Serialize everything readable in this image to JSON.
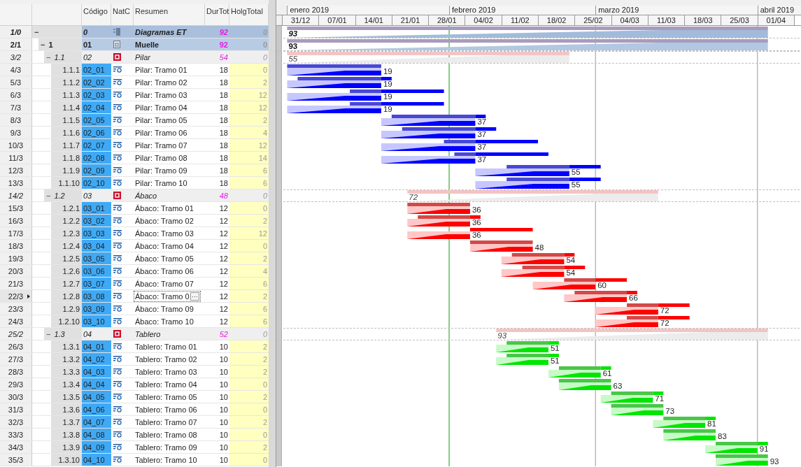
{
  "columns": [
    "Código",
    "NatC",
    "Resumen",
    "DurTot",
    "HolgTotal"
  ],
  "months": [
    "enero 2019",
    "febrero 2019",
    "marzo 2019",
    "abril 2019"
  ],
  "weeks": [
    "31/12",
    "07/01",
    "14/01",
    "21/01",
    "28/01",
    "04/02",
    "11/02",
    "18/02",
    "25/02",
    "04/03",
    "11/03",
    "18/03",
    "25/03",
    "01/04"
  ],
  "rows": [
    {
      "kind": "root",
      "num": "1/0",
      "toggle": "−",
      "selected": false,
      "code": "0",
      "summary": "Diagramas ET",
      "dur": "92",
      "holg": "0",
      "bar_label": "93",
      "children": [
        {
          "kind": "chapter",
          "num": "2/1",
          "toggle": "−",
          "index": "1",
          "selected": false,
          "code": "01",
          "summary": "Muelle",
          "dur": "92",
          "holg": "0",
          "bar_label": "93",
          "children": [
            {
              "kind": "group",
              "num": "3/2",
              "toggle": "−",
              "index": "1.1",
              "selected": false,
              "code": "02",
              "summary": "Pilar",
              "dur": "54",
              "holg": "0",
              "bar_label": "55",
              "color": "#0000ff",
              "children": [
                {
                  "kind": "task",
                  "num": "4/3",
                  "index": "1.1.1",
                  "selected": false,
                  "code": "02_01",
                  "summary": "Pilar: Tramo 01",
                  "dur": "18",
                  "holg": "0",
                  "bar_label": "19"
                },
                {
                  "kind": "task",
                  "num": "5/3",
                  "index": "1.1.2",
                  "selected": false,
                  "code": "02_02",
                  "summary": "Pilar: Tramo 02",
                  "dur": "18",
                  "holg": "2",
                  "bar_label": "19"
                },
                {
                  "kind": "task",
                  "num": "6/3",
                  "index": "1.1.3",
                  "selected": false,
                  "code": "02_03",
                  "summary": "Pilar: Tramo 03",
                  "dur": "18",
                  "holg": "12",
                  "bar_label": "19"
                },
                {
                  "kind": "task",
                  "num": "7/3",
                  "index": "1.1.4",
                  "selected": false,
                  "code": "02_04",
                  "summary": "Pilar: Tramo 04",
                  "dur": "18",
                  "holg": "12",
                  "bar_label": "19"
                },
                {
                  "kind": "task",
                  "num": "8/3",
                  "index": "1.1.5",
                  "selected": false,
                  "code": "02_05",
                  "summary": "Pilar: Tramo 05",
                  "dur": "18",
                  "holg": "2",
                  "bar_label": "37"
                },
                {
                  "kind": "task",
                  "num": "9/3",
                  "index": "1.1.6",
                  "selected": false,
                  "code": "02_06",
                  "summary": "Pilar: Tramo 06",
                  "dur": "18",
                  "holg": "4",
                  "bar_label": "37"
                },
                {
                  "kind": "task",
                  "num": "10/3",
                  "index": "1.1.7",
                  "selected": false,
                  "code": "02_07",
                  "summary": "Pilar: Tramo 07",
                  "dur": "18",
                  "holg": "12",
                  "bar_label": "37"
                },
                {
                  "kind": "task",
                  "num": "11/3",
                  "index": "1.1.8",
                  "selected": false,
                  "code": "02_08",
                  "summary": "Pilar: Tramo 08",
                  "dur": "18",
                  "holg": "14",
                  "bar_label": "37"
                },
                {
                  "kind": "task",
                  "num": "12/3",
                  "index": "1.1.9",
                  "selected": false,
                  "code": "02_09",
                  "summary": "Pilar: Tramo 09",
                  "dur": "18",
                  "holg": "6",
                  "bar_label": "55"
                },
                {
                  "kind": "task",
                  "num": "13/3",
                  "index": "1.1.10",
                  "selected": false,
                  "code": "02_10",
                  "summary": "Pilar: Tramo 10",
                  "dur": "18",
                  "holg": "6",
                  "bar_label": "55"
                }
              ]
            },
            {
              "kind": "group",
              "num": "14/2",
              "toggle": "−",
              "index": "1.2",
              "selected": false,
              "code": "03",
              "summary": "Ábaco",
              "dur": "48",
              "holg": "0",
              "bar_label": "72",
              "color": "#ff0000",
              "children": [
                {
                  "kind": "task",
                  "num": "15/3",
                  "index": "1.2.1",
                  "selected": false,
                  "code": "03_01",
                  "summary": "Ábaco: Tramo 01",
                  "dur": "12",
                  "holg": "0",
                  "bar_label": "36"
                },
                {
                  "kind": "task",
                  "num": "16/3",
                  "index": "1.2.2",
                  "selected": false,
                  "code": "03_02",
                  "summary": "Ábaco: Tramo 02",
                  "dur": "12",
                  "holg": "2",
                  "bar_label": "36"
                },
                {
                  "kind": "task",
                  "num": "17/3",
                  "index": "1.2.3",
                  "selected": false,
                  "code": "03_03",
                  "summary": "Ábaco: Tramo 03",
                  "dur": "12",
                  "holg": "12",
                  "bar_label": "36"
                },
                {
                  "kind": "task",
                  "num": "18/3",
                  "index": "1.2.4",
                  "selected": false,
                  "code": "03_04",
                  "summary": "Ábaco: Tramo 04",
                  "dur": "12",
                  "holg": "0",
                  "bar_label": "48"
                },
                {
                  "kind": "task",
                  "num": "19/3",
                  "index": "1.2.5",
                  "selected": false,
                  "code": "03_05",
                  "summary": "Ábaco: Tramo 05",
                  "dur": "12",
                  "holg": "2",
                  "bar_label": "54"
                },
                {
                  "kind": "task",
                  "num": "20/3",
                  "index": "1.2.6",
                  "selected": false,
                  "code": "03_06",
                  "summary": "Ábaco: Tramo 06",
                  "dur": "12",
                  "holg": "4",
                  "bar_label": "54"
                },
                {
                  "kind": "task",
                  "num": "21/3",
                  "index": "1.2.7",
                  "selected": false,
                  "code": "03_07",
                  "summary": "Ábaco: Tramo 07",
                  "dur": "12",
                  "holg": "6",
                  "bar_label": "60"
                },
                {
                  "kind": "task",
                  "num": "22/3",
                  "index": "1.2.8",
                  "selected": true,
                  "code": "03_08",
                  "summary": "Ábaco: Tramo 0",
                  "editor_button": "···",
                  "dur": "12",
                  "holg": "2",
                  "bar_label": "66"
                },
                {
                  "kind": "task",
                  "num": "23/3",
                  "index": "1.2.9",
                  "selected": false,
                  "code": "03_09",
                  "summary": "Ábaco: Tramo 09",
                  "dur": "12",
                  "holg": "6",
                  "bar_label": "72"
                },
                {
                  "kind": "task",
                  "num": "24/3",
                  "index": "1.2.10",
                  "selected": false,
                  "code": "03_10",
                  "summary": "Ábaco: Tramo 10",
                  "dur": "12",
                  "holg": "6",
                  "bar_label": "72"
                }
              ]
            },
            {
              "kind": "group",
              "num": "25/2",
              "toggle": "−",
              "index": "1.3",
              "selected": false,
              "code": "04",
              "summary": "Tablero",
              "dur": "52",
              "holg": "0",
              "bar_label": "93",
              "color": "#00e600",
              "children": [
                {
                  "kind": "task",
                  "num": "26/3",
                  "index": "1.3.1",
                  "selected": false,
                  "code": "04_01",
                  "summary": "Tablero: Tramo 01",
                  "dur": "10",
                  "holg": "2",
                  "bar_label": "51"
                },
                {
                  "kind": "task",
                  "num": "27/3",
                  "index": "1.3.2",
                  "selected": false,
                  "code": "04_02",
                  "summary": "Tablero: Tramo 02",
                  "dur": "10",
                  "holg": "2",
                  "bar_label": "51"
                },
                {
                  "kind": "task",
                  "num": "28/3",
                  "index": "1.3.3",
                  "selected": false,
                  "code": "04_03",
                  "summary": "Tablero: Tramo 03",
                  "dur": "10",
                  "holg": "2",
                  "bar_label": "61"
                },
                {
                  "kind": "task",
                  "num": "29/3",
                  "index": "1.3.4",
                  "selected": false,
                  "code": "04_04",
                  "summary": "Tablero: Tramo 04",
                  "dur": "10",
                  "holg": "0",
                  "bar_label": "63"
                },
                {
                  "kind": "task",
                  "num": "30/3",
                  "index": "1.3.5",
                  "selected": false,
                  "code": "04_05",
                  "summary": "Tablero: Tramo 05",
                  "dur": "10",
                  "holg": "2",
                  "bar_label": "71"
                },
                {
                  "kind": "task",
                  "num": "31/3",
                  "index": "1.3.6",
                  "selected": false,
                  "code": "04_06",
                  "summary": "Tablero: Tramo 06",
                  "dur": "10",
                  "holg": "0",
                  "bar_label": "73"
                },
                {
                  "kind": "task",
                  "num": "32/3",
                  "index": "1.3.7",
                  "selected": false,
                  "code": "04_07",
                  "summary": "Tablero: Tramo 07",
                  "dur": "10",
                  "holg": "2",
                  "bar_label": "81"
                },
                {
                  "kind": "task",
                  "num": "33/3",
                  "index": "1.3.8",
                  "selected": false,
                  "code": "04_08",
                  "summary": "Tablero: Tramo 08",
                  "dur": "10",
                  "holg": "0",
                  "bar_label": "83"
                },
                {
                  "kind": "task",
                  "num": "34/3",
                  "index": "1.3.9",
                  "selected": false,
                  "code": "04_09",
                  "summary": "Tablero: Tramo 09",
                  "dur": "10",
                  "holg": "2",
                  "bar_label": "91"
                },
                {
                  "kind": "task",
                  "num": "35/3",
                  "index": "1.3.10",
                  "selected": false,
                  "code": "04_10",
                  "summary": "Tablero: Tramo 10",
                  "dur": "10",
                  "holg": "0",
                  "bar_label": "93"
                }
              ]
            }
          ]
        }
      ]
    }
  ]
}
